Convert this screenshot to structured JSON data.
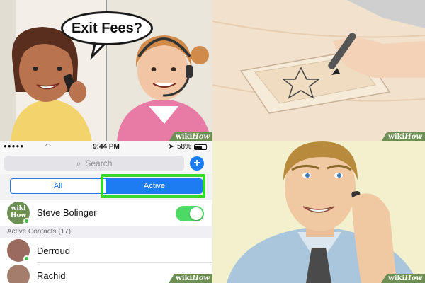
{
  "illustrations": {
    "call": {
      "bubble_text": "Exit Fees?"
    },
    "watermark": {
      "wiki": "wiki",
      "how": "How"
    }
  },
  "phone": {
    "status": {
      "time": "9:44 PM",
      "battery": "58%"
    },
    "search": {
      "placeholder": "Search",
      "add_label": "+"
    },
    "tabs": [
      {
        "label": "All",
        "active": false
      },
      {
        "label": "Active",
        "active": true
      }
    ],
    "self": {
      "name": "Steve Bolinger",
      "avatar_text": "wiki How",
      "online_toggle": true
    },
    "section_header": "Active Contacts (17)",
    "contacts": [
      {
        "name": "Derroud"
      },
      {
        "name": "Rachid"
      }
    ]
  },
  "colors": {
    "accent": "#1e7cf2",
    "highlight": "#38d92e",
    "online": "#4cd964",
    "wikihow": "#6e8f54"
  }
}
